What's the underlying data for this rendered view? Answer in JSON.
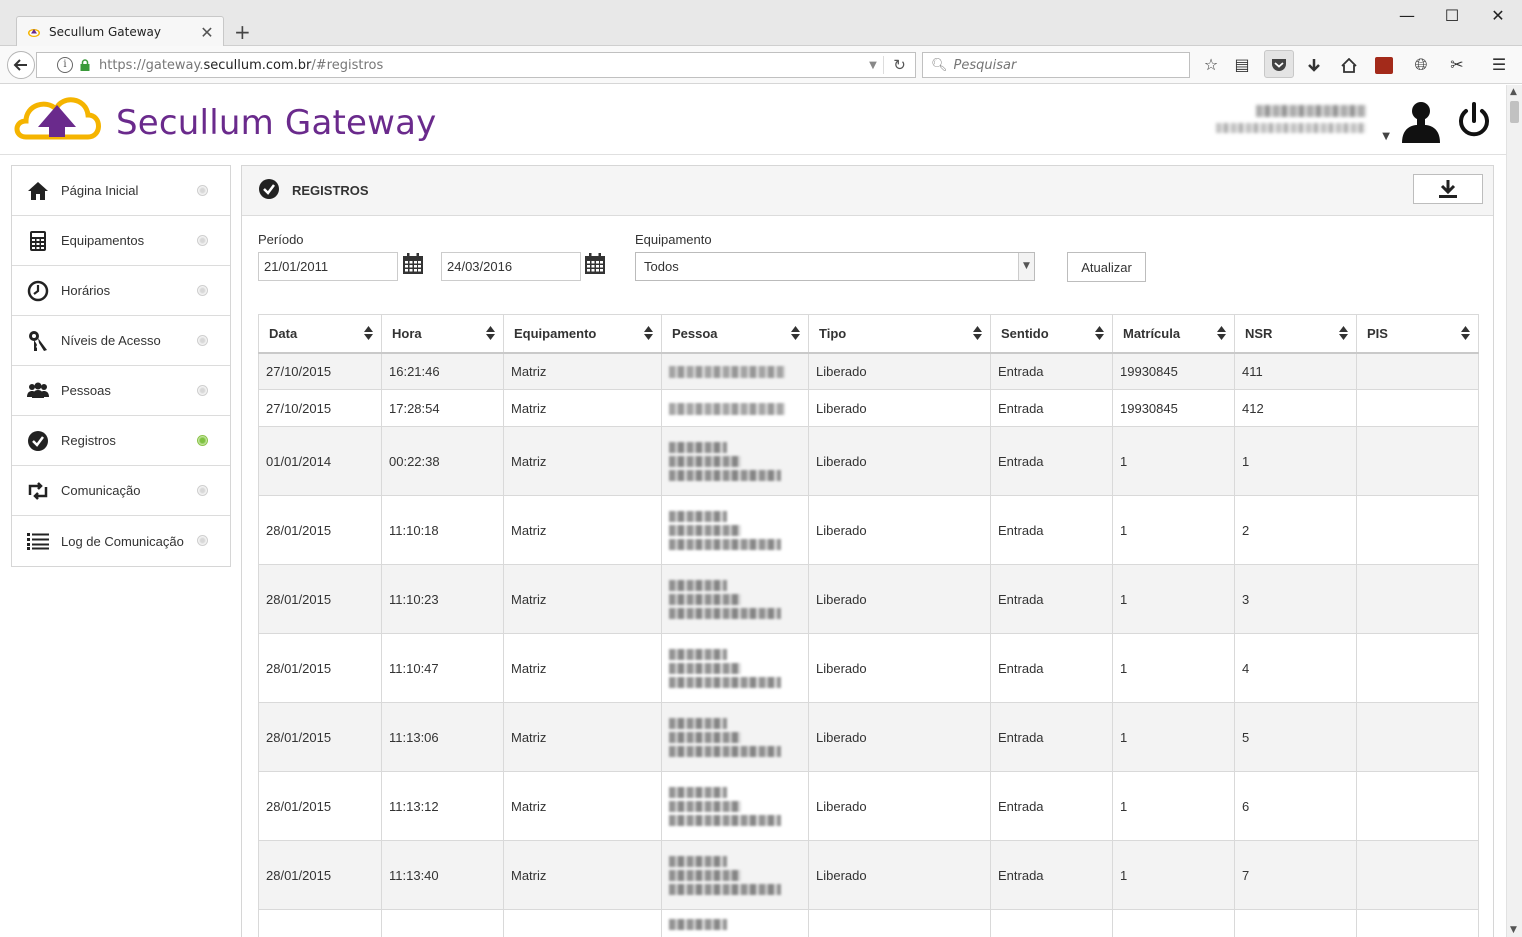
{
  "browser": {
    "tab_title": "Secullum Gateway",
    "close_glyph": "✕",
    "newtab_glyph": "+",
    "url_prefix": "https://gateway.",
    "url_domain": "secullum.com.br",
    "url_suffix": "/#registros",
    "search_placeholder": "Pesquisar",
    "window_controls": [
      "—",
      "☐",
      "✕"
    ]
  },
  "header": {
    "app_title": "Secullum Gateway",
    "brand_color": "#6a2a8c",
    "logo_colors": [
      "#f5b400",
      "#6a2a8c"
    ]
  },
  "sidebar": {
    "items": [
      {
        "label": "Página Inicial",
        "icon": "home-icon",
        "active": false
      },
      {
        "label": "Equipamentos",
        "icon": "calculator-icon",
        "active": false
      },
      {
        "label": "Horários",
        "icon": "clock-icon",
        "active": false
      },
      {
        "label": "Níveis de Acesso",
        "icon": "keys-icon",
        "active": false
      },
      {
        "label": "Pessoas",
        "icon": "people-icon",
        "active": false
      },
      {
        "label": "Registros",
        "icon": "check-circle-icon",
        "active": true
      },
      {
        "label": "Comunicação",
        "icon": "retweet-icon",
        "active": false
      },
      {
        "label": "Log de Comunicação",
        "icon": "list-icon",
        "active": false
      }
    ],
    "active_color": "#7fc241"
  },
  "panel": {
    "title": "REGISTROS",
    "filters": {
      "periodo_label": "Período",
      "date_from": "21/01/2011",
      "date_to": "24/03/2016",
      "equip_label": "Equipamento",
      "equip_selected": "Todos",
      "update_label": "Atualizar"
    },
    "table": {
      "columns": [
        "Data",
        "Hora",
        "Equipamento",
        "Pessoa",
        "Tipo",
        "Sentido",
        "Matrícula",
        "NSR",
        "PIS"
      ],
      "rows": [
        {
          "data": "27/10/2015",
          "hora": "16:21:46",
          "equip": "Matriz",
          "tipo": "Liberado",
          "sentido": "Entrada",
          "matricula": "19930845",
          "nsr": "411",
          "pis": ""
        },
        {
          "data": "27/10/2015",
          "hora": "17:28:54",
          "equip": "Matriz",
          "tipo": "Liberado",
          "sentido": "Entrada",
          "matricula": "19930845",
          "nsr": "412",
          "pis": ""
        },
        {
          "data": "01/01/2014",
          "hora": "00:22:38",
          "equip": "Matriz",
          "tipo": "Liberado",
          "sentido": "Entrada",
          "matricula": "1",
          "nsr": "1",
          "pis": ""
        },
        {
          "data": "28/01/2015",
          "hora": "11:10:18",
          "equip": "Matriz",
          "tipo": "Liberado",
          "sentido": "Entrada",
          "matricula": "1",
          "nsr": "2",
          "pis": ""
        },
        {
          "data": "28/01/2015",
          "hora": "11:10:23",
          "equip": "Matriz",
          "tipo": "Liberado",
          "sentido": "Entrada",
          "matricula": "1",
          "nsr": "3",
          "pis": ""
        },
        {
          "data": "28/01/2015",
          "hora": "11:10:47",
          "equip": "Matriz",
          "tipo": "Liberado",
          "sentido": "Entrada",
          "matricula": "1",
          "nsr": "4",
          "pis": ""
        },
        {
          "data": "28/01/2015",
          "hora": "11:13:06",
          "equip": "Matriz",
          "tipo": "Liberado",
          "sentido": "Entrada",
          "matricula": "1",
          "nsr": "5",
          "pis": ""
        },
        {
          "data": "28/01/2015",
          "hora": "11:13:12",
          "equip": "Matriz",
          "tipo": "Liberado",
          "sentido": "Entrada",
          "matricula": "1",
          "nsr": "6",
          "pis": ""
        },
        {
          "data": "28/01/2015",
          "hora": "11:13:40",
          "equip": "Matriz",
          "tipo": "Liberado",
          "sentido": "Entrada",
          "matricula": "1",
          "nsr": "7",
          "pis": ""
        }
      ]
    }
  }
}
